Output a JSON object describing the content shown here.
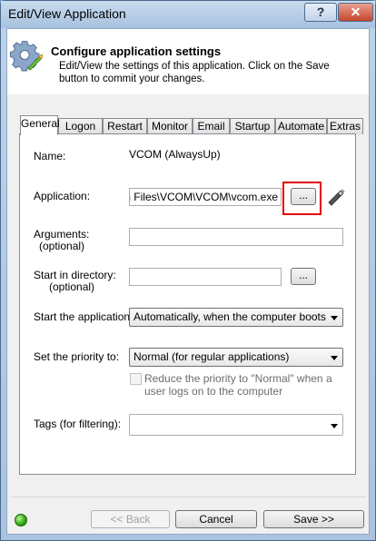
{
  "window": {
    "title": "Edit/View Application",
    "help_label": "?",
    "close_label": "✕"
  },
  "header": {
    "title": "Configure application settings",
    "description": "Edit/View the settings of this application. Click on the Save button to commit your changes."
  },
  "tabs": [
    "General",
    "Logon",
    "Restart",
    "Monitor",
    "Email",
    "Startup",
    "Automate",
    "Extras"
  ],
  "active_tab": "General",
  "form": {
    "name_label": "Name:",
    "name_value": "VCOM (AlwaysUp)",
    "application_label": "Application:",
    "application_value": "C:\\Program Files\\VCOM\\VCOM\\vcom.exe",
    "browse_label": "...",
    "arguments_label": "Arguments:",
    "arguments_optional": "(optional)",
    "arguments_value": "",
    "start_dir_label": "Start in directory:",
    "start_dir_optional": "(optional)",
    "start_dir_value": "",
    "start_dir_browse_label": "...",
    "start_app_label": "Start the application:",
    "start_app_value": "Automatically, when the computer boots",
    "priority_label": "Set the priority to:",
    "priority_value": "Normal (for regular applications)",
    "reduce_priority_text": "Reduce the priority to \"Normal\" when a user logs on to the computer",
    "reduce_priority_checked": false,
    "tags_label": "Tags (for filtering):",
    "tags_value": ""
  },
  "footer": {
    "back_label": "<< Back",
    "cancel_label": "Cancel",
    "save_label": "Save >>"
  },
  "icons": {
    "header": "gear-settings-icon",
    "status": "green-status-dot",
    "application_test": "wand-icon"
  },
  "colors": {
    "highlight": "#e30000",
    "status": "#2fa60e"
  }
}
